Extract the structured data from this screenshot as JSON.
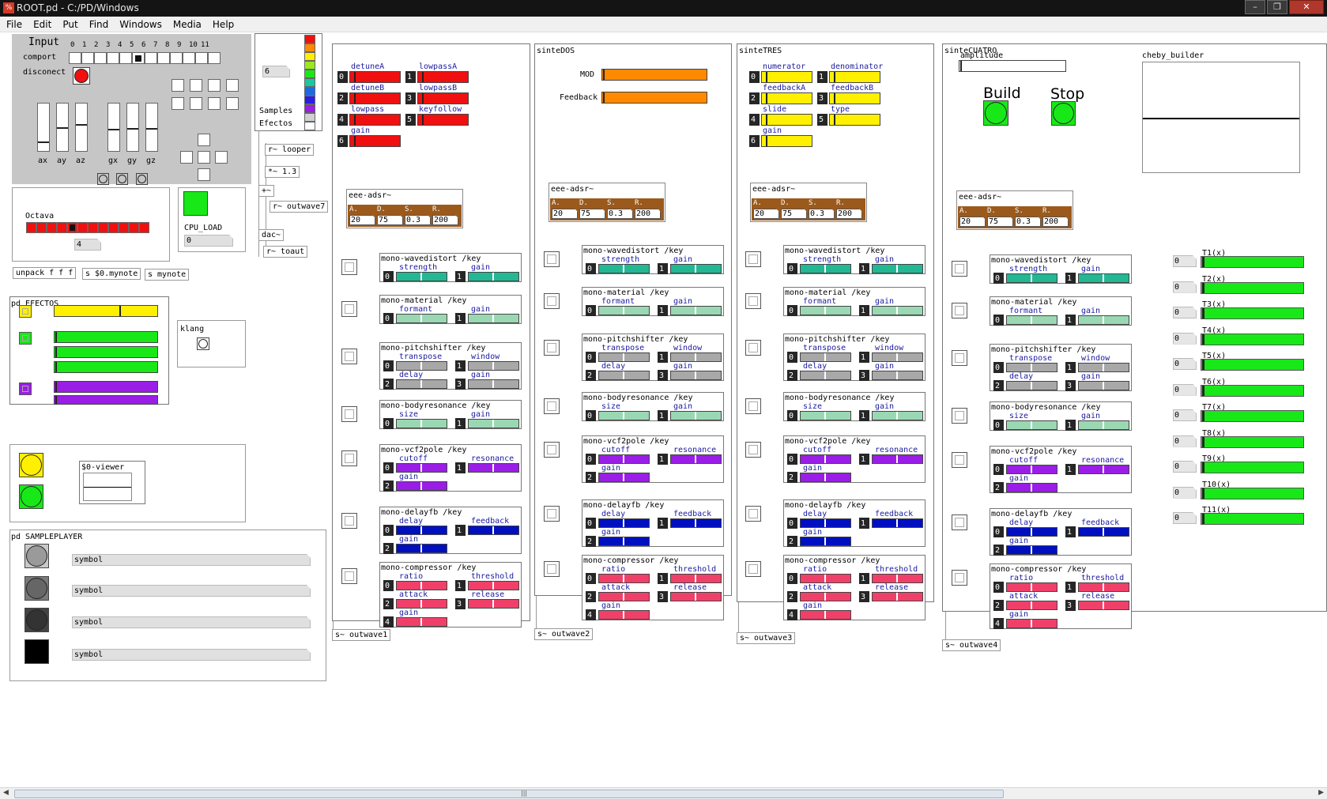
{
  "window": {
    "title": "ROOT.pd  - C:/PD/Windows",
    "icon_text": "%",
    "buttons": [
      "–",
      "❐",
      "✕"
    ]
  },
  "menu": [
    "File",
    "Edit",
    "Put",
    "Find",
    "Windows",
    "Media",
    "Help"
  ],
  "input_panel": {
    "title": "Input",
    "comport_label": "comport",
    "disconnect_label": "disconect",
    "digits": [
      "0",
      "1",
      "2",
      "3",
      "4",
      "5",
      "6",
      "7",
      "8",
      "9",
      "10",
      "11"
    ],
    "axes": [
      "ax",
      "ay",
      "az",
      "gx",
      "gy",
      "gz"
    ]
  },
  "octava": {
    "label": "Octava",
    "value": "4",
    "unpack": "unpack f f f",
    "s1": "s $0.mynote",
    "s2": "s mynote"
  },
  "cpu": {
    "label": "CPU_LOAD",
    "value": "0"
  },
  "samples": {
    "value": "6",
    "label1": "Samples",
    "label2": "Efectos"
  },
  "wires_objs": {
    "looper": "r~ looper",
    "mul": "*~ 1.3",
    "tilde": "+~",
    "outwave7": "r~ outwave7",
    "dac": "dac~",
    "toaut": "r~ toaut"
  },
  "efectos": {
    "title": "pd EFECTOS"
  },
  "klang": {
    "title": "klang"
  },
  "viewer": {
    "title": "$0-viewer"
  },
  "sampleplayer": {
    "title": "pd SAMPLEPLAYER",
    "symbols": [
      "symbol",
      "symbol",
      "symbol",
      "symbol"
    ]
  },
  "adsr": {
    "title": "eee-adsr~",
    "letters": [
      "A.",
      "D.",
      "S.",
      "R."
    ],
    "values": [
      "20",
      "75",
      "0.3",
      "200"
    ]
  },
  "synths": [
    {
      "title": "",
      "out": "s~ outwave1",
      "params": [
        {
          "n": "0",
          "l": "detuneA"
        },
        {
          "n": "1",
          "l": "lowpassA"
        },
        {
          "n": "2",
          "l": "detuneB"
        },
        {
          "n": "3",
          "l": "lowpassB"
        },
        {
          "n": "4",
          "l": "lowpass"
        },
        {
          "n": "5",
          "l": "keyfollow"
        },
        {
          "n": "6",
          "l": "gain"
        }
      ]
    },
    {
      "title": "sinteDOS",
      "out": "s~ outwave2",
      "mod": "MOD",
      "fb": "Feedback"
    },
    {
      "title": "sinteTRES",
      "out": "s~ outwave3",
      "params": [
        {
          "n": "0",
          "l": "numerator"
        },
        {
          "n": "1",
          "l": "denominator"
        },
        {
          "n": "2",
          "l": "feedbackA"
        },
        {
          "n": "3",
          "l": "feedbackB"
        },
        {
          "n": "4",
          "l": "slide"
        },
        {
          "n": "5",
          "l": "type"
        },
        {
          "n": "6",
          "l": "gain"
        }
      ]
    },
    {
      "title": "sinteCUATRO",
      "out": "s~ outwave4",
      "amp": "amplitude",
      "build": "Build",
      "stop": "Stop",
      "cheby": "cheby_builder"
    }
  ],
  "fxchain": [
    {
      "title": "mono-wavedistort /key",
      "p": [
        [
          "0",
          "strength"
        ],
        [
          "1",
          "gain"
        ]
      ]
    },
    {
      "title": "mono-material /key",
      "p": [
        [
          "0",
          "formant"
        ],
        [
          "1",
          "gain"
        ]
      ]
    },
    {
      "title": "mono-pitchshifter /key",
      "p": [
        [
          "0",
          "transpose"
        ],
        [
          "1",
          "window"
        ],
        [
          "2",
          "delay"
        ],
        [
          "3",
          "gain"
        ]
      ]
    },
    {
      "title": "mono-bodyresonance /key",
      "p": [
        [
          "0",
          "size"
        ],
        [
          "1",
          "gain"
        ]
      ]
    },
    {
      "title": "mono-vcf2pole /key",
      "p": [
        [
          "0",
          "cutoff"
        ],
        [
          "1",
          "resonance"
        ],
        [
          "2",
          "gain"
        ]
      ]
    },
    {
      "title": "mono-delayfb /key",
      "p": [
        [
          "0",
          "delay"
        ],
        [
          "1",
          "feedback"
        ],
        [
          "2",
          "gain"
        ]
      ]
    },
    {
      "title": "mono-compressor /key",
      "p": [
        [
          "0",
          "ratio"
        ],
        [
          "1",
          "threshold"
        ],
        [
          "2",
          "attack"
        ],
        [
          "3",
          "release"
        ],
        [
          "4",
          "gain"
        ]
      ]
    }
  ],
  "cheby_terms": [
    {
      "l": "T1(x)",
      "v": "0"
    },
    {
      "l": "T2(x)",
      "v": "0"
    },
    {
      "l": "T3(x)",
      "v": "0"
    },
    {
      "l": "T4(x)",
      "v": "0"
    },
    {
      "l": "T5(x)",
      "v": "0"
    },
    {
      "l": "T6(x)",
      "v": "0"
    },
    {
      "l": "T7(x)",
      "v": "0"
    },
    {
      "l": "T8(x)",
      "v": "0"
    },
    {
      "l": "T9(x)",
      "v": "0"
    },
    {
      "l": "T10(x)",
      "v": "0"
    },
    {
      "l": "T11(x)",
      "v": "0"
    }
  ],
  "colors": {
    "red": "#f01010",
    "green": "#18e818",
    "yellow": "#fff000",
    "violet": "#9a1ee6",
    "teal": "#22b894",
    "mint": "#9ad8b4",
    "grey": "#a8a8a8",
    "blue": "#0010c0",
    "pink": "#f0406a",
    "orange": "#ff8a00",
    "brown": "#9b5a1c"
  }
}
